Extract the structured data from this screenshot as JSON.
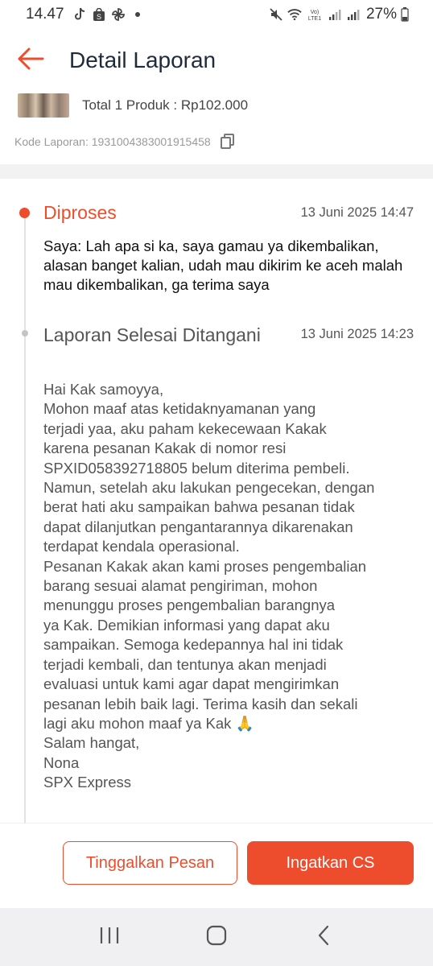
{
  "status_bar": {
    "time": "14.47",
    "battery": "27%",
    "icons": [
      "tiktok-icon",
      "shopee-icon",
      "pinwheel-icon",
      "dot-icon",
      "mute-icon",
      "wifi-icon",
      "volte-icon",
      "signal-icon",
      "signal-icon",
      "battery-icon"
    ]
  },
  "header": {
    "title": "Detail Laporan",
    "back_icon": "arrow-left-icon"
  },
  "product": {
    "total": "Total 1 Produk : Rp102.000"
  },
  "report": {
    "code": "Kode Laporan: 193100438300191545​8",
    "copy_icon": "copy-icon"
  },
  "timeline": [
    {
      "status": "Diproses",
      "time": "13 Juni 2025 14:47",
      "message": "Saya: Lah apa si ka, saya gamau ya dikembalikan, alasan banget kalian, udah mau dikirim ke aceh malah mau dikembalikan, ga terima saya"
    },
    {
      "status": "Laporan Selesai Ditangani",
      "time": "13 Juni 2025 14:23",
      "message": "Hai Kak samoyya,\nMohon maaf atas ketidaknyamanan yang\nterjadi yaa, aku paham kekecewaan Kakak\nkarena pesanan Kakak di nomor resi\nSPXID058392718805 belum diterima pembeli.\nNamun, setelah aku lakukan pengecekan, dengan\nberat hati aku sampaikan bahwa pesanan tidak\ndapat dilanjutkan pengantarannya dikarenakan\nterdapat kendala operasional.\nPesanan Kakak akan kami proses pengembalian\nbarang sesuai alamat pengiriman, mohon\nmenunggu proses pengembalian barangnya\nya Kak. Demikian informasi yang dapat aku\nsampaikan. Semoga kedepannya hal ini tidak\nterjadi kembali, dan tentunya akan menjadi\nevaluasi untuk kami agar dapat mengirimkan\npesanan lebih baik lagi. Terima kasih dan sekali\nlagi aku mohon maaf ya Kak 🙏\nSalam hangat,\nNona\nSPX Express"
    }
  ],
  "footer": {
    "leave_message": "Tinggalkan Pesan",
    "remind_cs": "Ingatkan CS"
  },
  "nav": {
    "icons": [
      "recents-icon",
      "home-icon",
      "back-icon"
    ]
  },
  "colors": {
    "accent": "#ee4d2d",
    "title": "#1f2a3a",
    "muted": "#9a9a9a"
  }
}
